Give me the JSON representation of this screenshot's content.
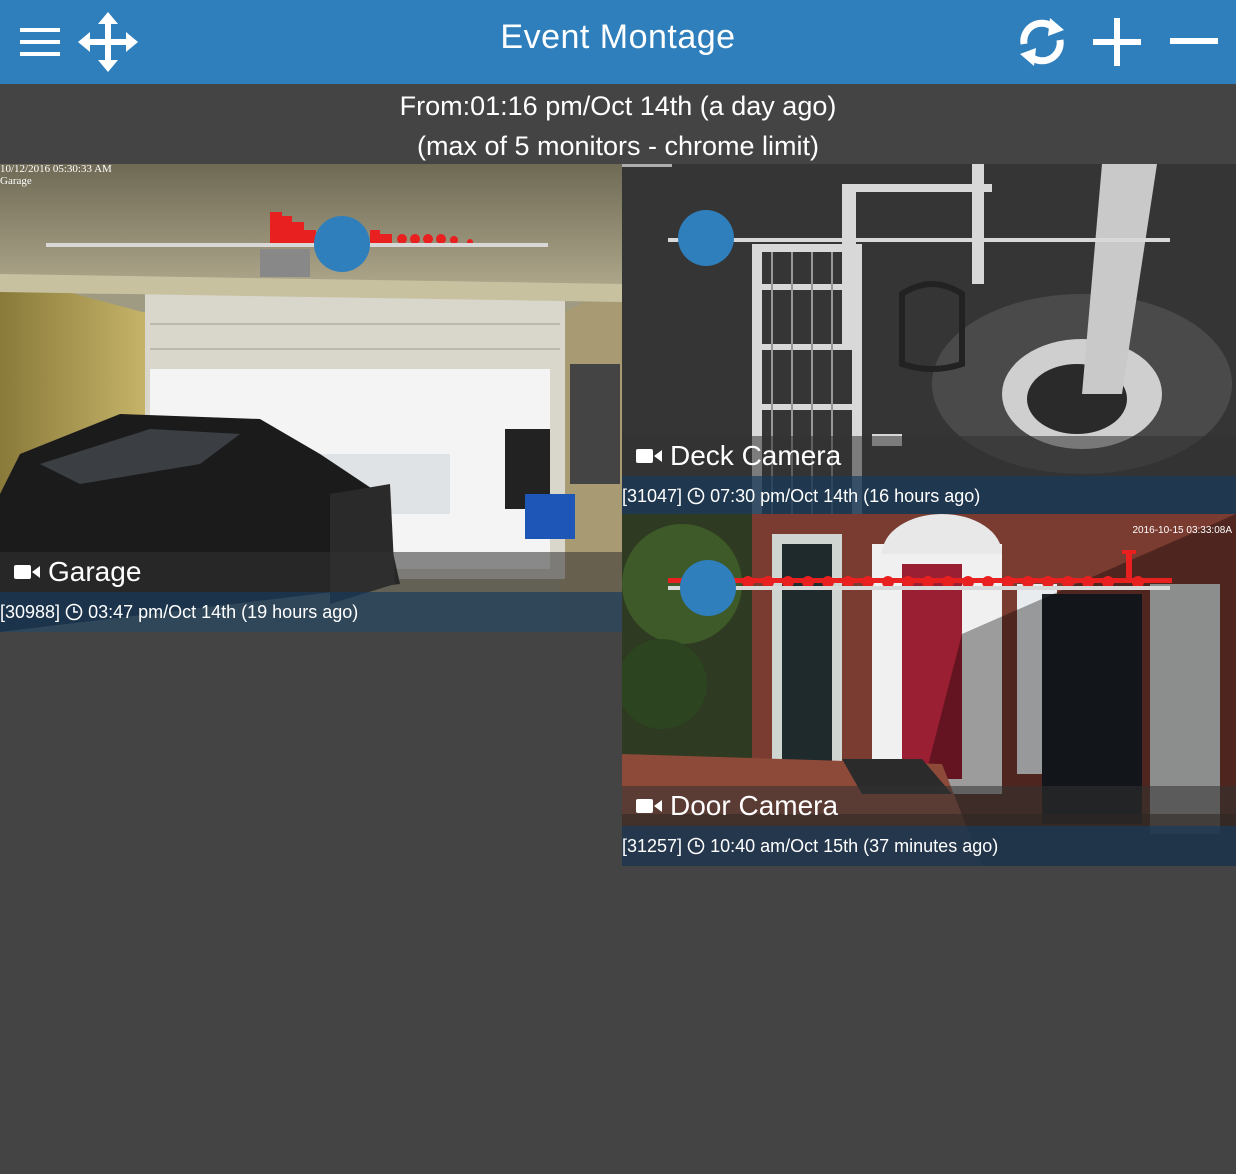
{
  "header": {
    "title": "Event Montage",
    "bg_color": "#2f7fbc",
    "left_icons": [
      "menu-icon",
      "move-icon"
    ],
    "right_icons": [
      "refresh-icon",
      "zoom-in-icon",
      "zoom-out-icon"
    ]
  },
  "info": {
    "from_line": "From:01:16 pm/Oct 14th (a day ago)",
    "limit_line": "(max of 5 monitors - chrome limit)"
  },
  "monitors": [
    {
      "name": "Garage",
      "event_id": "[30988]",
      "time": "03:47 pm/Oct 14th (19 hours ago)",
      "overlay_stamp": "10/12/2016 05:30:33 AM",
      "overlay_label": "Garage"
    },
    {
      "name": "Deck Camera",
      "event_id": "[31047]",
      "time": "07:30 pm/Oct 14th (16 hours ago)"
    },
    {
      "name": "Door Camera",
      "event_id": "[31257]",
      "time": "10:40 am/Oct 15th (37 minutes ago)",
      "overlay_stamp": "2016-10-15 03:33:08A"
    }
  ],
  "colors": {
    "background": "#444444",
    "accent": "#2f7fbc",
    "event_marks": "#e82020",
    "meta_bar": "#1c3854"
  }
}
